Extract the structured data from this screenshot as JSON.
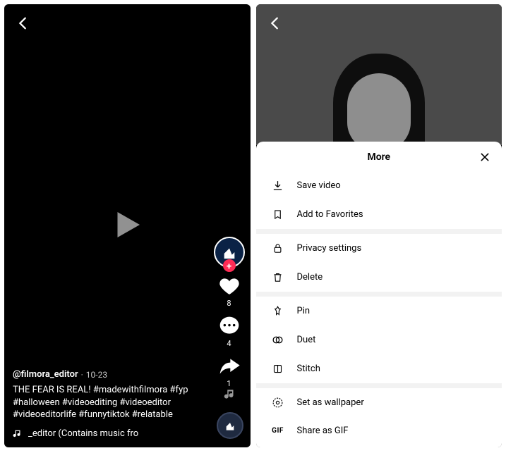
{
  "left": {
    "username": "@filmora_editor",
    "date": "10-23",
    "caption": "THE FEAR IS REAL! #madewithfilmora #fyp #halloween #videoediting #videoeditor #videoeditorlife #funnytiktok #relatable",
    "music_text": "_editor (Contains music fro",
    "actions": {
      "like_count": "8",
      "comment_count": "4",
      "share_count": "1"
    }
  },
  "right": {
    "sheet_title": "More",
    "menu": {
      "save_video": "Save video",
      "add_favorites": "Add to Favorites",
      "privacy_settings": "Privacy settings",
      "delete": "Delete",
      "pin": "Pin",
      "duet": "Duet",
      "stitch": "Stitch",
      "set_wallpaper": "Set as wallpaper",
      "share_gif": "Share as GIF"
    }
  }
}
